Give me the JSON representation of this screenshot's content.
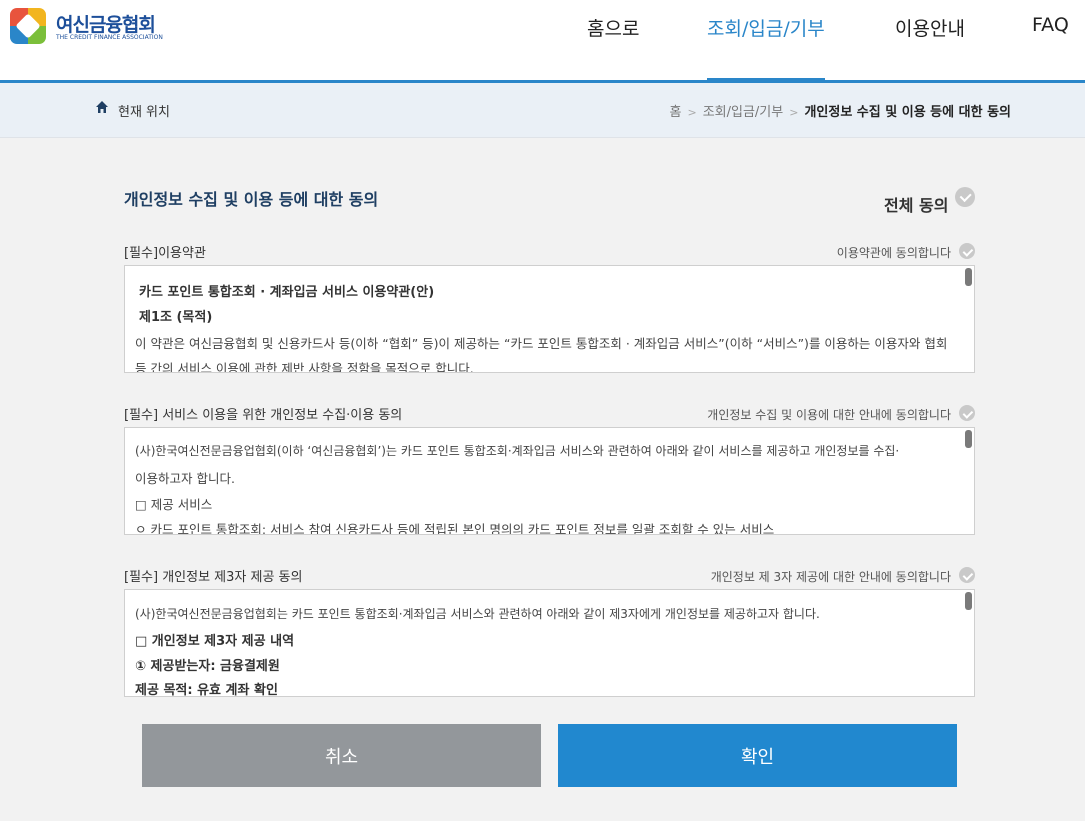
{
  "header": {
    "logo_title": "여신금융협회",
    "logo_subtitle": "THE CREDIT FINANCE ASSOCIATION",
    "nav": [
      {
        "label": "홈으로",
        "active": false
      },
      {
        "label": "조회/입금/기부",
        "active": true
      },
      {
        "label": "이용안내",
        "active": false
      },
      {
        "label": "FAQ",
        "active": false
      }
    ],
    "accent_color": "#2a86c9"
  },
  "breadcrumb": {
    "location_label": "현재 위치",
    "items": [
      "홈",
      "조회/입금/기부",
      "개인정보 수집 및 이용 등에 대한 동의"
    ]
  },
  "main": {
    "title": "개인정보 수집 및 이용 등에 대한 동의",
    "all_agree_label": "전체 동의",
    "sections": [
      {
        "title": "[필수]이용약관",
        "agree_label": "이용약관에 동의합니다",
        "lines": [
          "카드 포인트 통합조회 · 계좌입금 서비스 이용약관(안)",
          "제1조 (목적)",
          "이 약관은 여신금융협회 및 신용카드사 등(이하 “협회” 등)이 제공하는 “카드 포인트 통합조회 · 계좌입금 서비스”(이하 “서비스”)를 이용하는 이용자와 협회",
          "등 간의 서비스 이용에 관한 제반 사항을 정함을 목적으로 합니다."
        ]
      },
      {
        "title": "[필수] 서비스 이용을 위한 개인정보 수집·이용 동의",
        "agree_label": "개인정보 수집 및 이용에 대한 안내에 동의합니다",
        "lines": [
          "(사)한국여신전문금융업협회(이하 ‘여신금융협회’)는 카드 포인트 통합조회·계좌입금 서비스와 관련하여 아래와 같이 서비스를 제공하고 개인정보를 수집·",
          "이용하고자 합니다.",
          "□ 제공 서비스",
          "ㅇ 카드 포인트 통합조회: 서비스 참여 신용카드사 등에 적립된 본인 명의의 카드 포인트 정보를 일괄 조회할 수 있는 서비스"
        ]
      },
      {
        "title": "[필수] 개인정보 제3자 제공 동의",
        "agree_label": "개인정보 제 3자 제공에 대한 안내에 동의합니다",
        "lines": [
          "(사)한국여신전문금융업협회는 카드 포인트 통합조회·계좌입금 서비스와 관련하여 아래와 같이 제3자에게 개인정보를 제공하고자 합니다.",
          "□ 개인정보 제3자 제공 내역",
          "① 제공받는자: 금융결제원",
          "제공 목적: 유효 계좌 확인"
        ]
      }
    ]
  },
  "buttons": {
    "cancel_label": "취소",
    "confirm_label": "확인"
  }
}
